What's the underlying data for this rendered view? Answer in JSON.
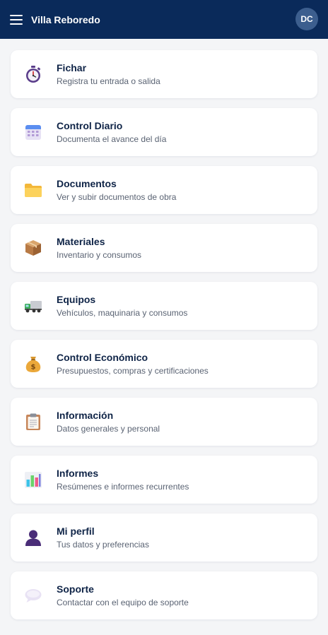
{
  "header": {
    "title": "Villa Reboredo",
    "avatar_initials": "DC"
  },
  "items": [
    {
      "title": "Fichar",
      "subtitle": "Registra tu entrada o salida",
      "icon": "stopwatch-icon"
    },
    {
      "title": "Control Diario",
      "subtitle": "Documenta el avance del día",
      "icon": "calendar-icon"
    },
    {
      "title": "Documentos",
      "subtitle": "Ver y subir documentos de obra",
      "icon": "folder-icon"
    },
    {
      "title": "Materiales",
      "subtitle": "Inventario y consumos",
      "icon": "box-icon"
    },
    {
      "title": "Equipos",
      "subtitle": "Vehículos, maquinaria y consumos",
      "icon": "truck-icon"
    },
    {
      "title": "Control Económico",
      "subtitle": "Presupuestos, compras y certificaciones",
      "icon": "money-bag-icon"
    },
    {
      "title": "Información",
      "subtitle": "Datos generales y personal",
      "icon": "clipboard-icon"
    },
    {
      "title": "Informes",
      "subtitle": "Resúmenes e informes recurrentes",
      "icon": "bar-chart-icon"
    },
    {
      "title": "Mi perfil",
      "subtitle": "Tus datos y preferencias",
      "icon": "user-icon"
    },
    {
      "title": "Soporte",
      "subtitle": "Contactar con el equipo de soporte",
      "icon": "speech-bubble-icon"
    }
  ]
}
